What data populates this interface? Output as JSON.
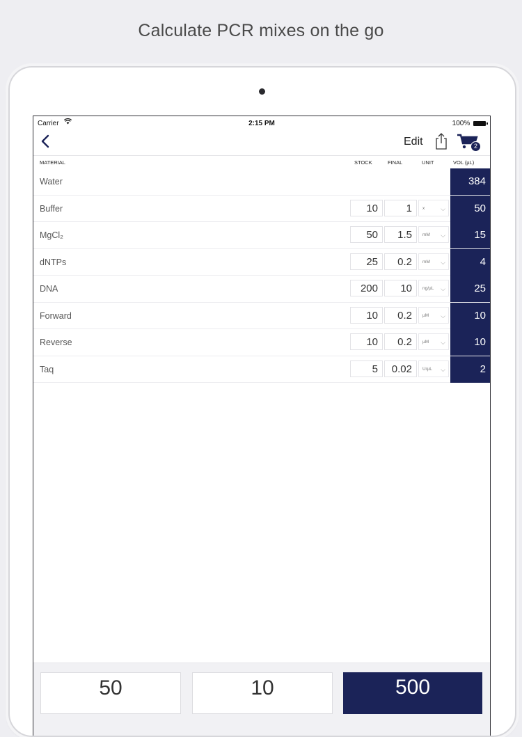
{
  "promo": {
    "headline": "Calculate PCR mixes on the go"
  },
  "status_bar": {
    "carrier": "Carrier",
    "time": "2:15 PM",
    "battery": "100%"
  },
  "nav": {
    "edit_label": "Edit",
    "cart_count": "2"
  },
  "columns": {
    "material": "MATERIAL",
    "stock": "STOCK",
    "final": "FINAL",
    "unit": "UNIT",
    "vol": "VOL (µL)"
  },
  "rows": [
    {
      "name": "Water",
      "stock": "",
      "final": "",
      "unit": "",
      "vol": "384"
    },
    {
      "name": "Buffer",
      "stock": "10",
      "final": "1",
      "unit": "x",
      "vol": "50"
    },
    {
      "name": "MgCl₂",
      "stock": "50",
      "final": "1.5",
      "unit": "mM",
      "vol": "15"
    },
    {
      "name": "dNTPs",
      "stock": "25",
      "final": "0.2",
      "unit": "mM",
      "vol": "4"
    },
    {
      "name": "DNA",
      "stock": "200",
      "final": "10",
      "unit": "ng/µL",
      "vol": "25"
    },
    {
      "name": "Forward",
      "stock": "10",
      "final": "0.2",
      "unit": "µM",
      "vol": "10"
    },
    {
      "name": "Reverse",
      "stock": "10",
      "final": "0.2",
      "unit": "µM",
      "vol": "10"
    },
    {
      "name": "Taq",
      "stock": "5",
      "final": "0.02",
      "unit": "U/µL",
      "vol": "2"
    }
  ],
  "totals": {
    "reaction_volume": "50",
    "reactions": "10",
    "total_volume": "500"
  },
  "colors": {
    "accent": "#1b2358"
  }
}
